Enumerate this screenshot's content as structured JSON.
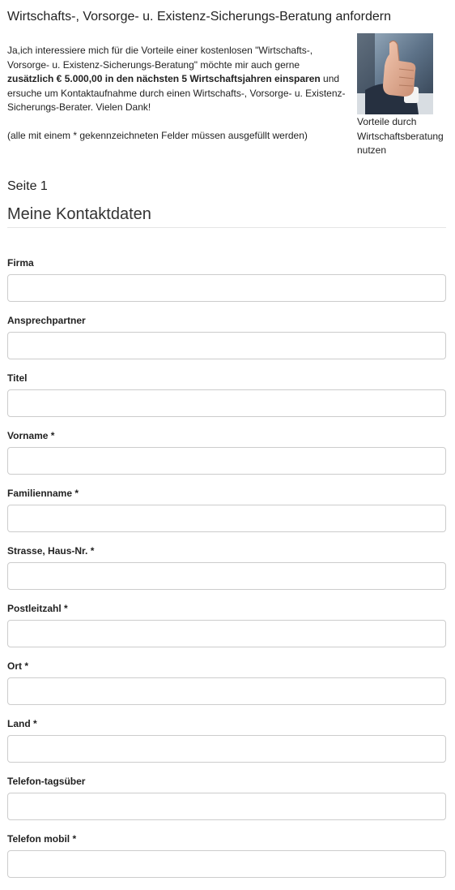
{
  "header": {
    "title": "Wirtschafts-, Vorsorge- u. Existenz-Sicherungs-Beratung anfordern"
  },
  "intro": {
    "text_before": "Ja,ich interessiere mich für die Vorteile einer kostenlosen \"Wirtschafts-, Vorsorge- u. Existenz-Sicherungs-Beratung\" möchte mir auch gerne ",
    "text_bold": "zusätzlich € 5.000,00 in den nächsten 5 Wirtschaftsjahren einsparen",
    "text_after": " und ersuche um Kontaktaufnahme durch einen Wirtschafts-, Vorsorge- u. Existenz-Sicherungs-Berater. Vielen Dank!",
    "required_note": "(alle mit einem * gekennzeichneten Felder müssen ausgefüllt werden)"
  },
  "promo": {
    "image_icon": "thumbs-up-photo",
    "caption": "Vorteile durch Wirtschaftsberatung nutzen"
  },
  "form": {
    "page_label": "Seite 1",
    "section_title": "Meine Kontaktdaten",
    "fields": [
      {
        "label": "Firma",
        "value": "",
        "placeholder": ""
      },
      {
        "label": "Ansprechpartner",
        "value": "",
        "placeholder": ""
      },
      {
        "label": "Titel",
        "value": "",
        "placeholder": ""
      },
      {
        "label": "Vorname *",
        "value": "",
        "placeholder": ""
      },
      {
        "label": "Familienname *",
        "value": "",
        "placeholder": ""
      },
      {
        "label": "Strasse, Haus-Nr. *",
        "value": "",
        "placeholder": ""
      },
      {
        "label": "Postleitzahl *",
        "value": "",
        "placeholder": ""
      },
      {
        "label": "Ort *",
        "value": "",
        "placeholder": ""
      },
      {
        "label": "Land *",
        "value": "",
        "placeholder": ""
      },
      {
        "label": "Telefon-tagsüber",
        "value": "",
        "placeholder": ""
      },
      {
        "label": "Telefon mobil *",
        "value": "",
        "placeholder": ""
      }
    ]
  }
}
